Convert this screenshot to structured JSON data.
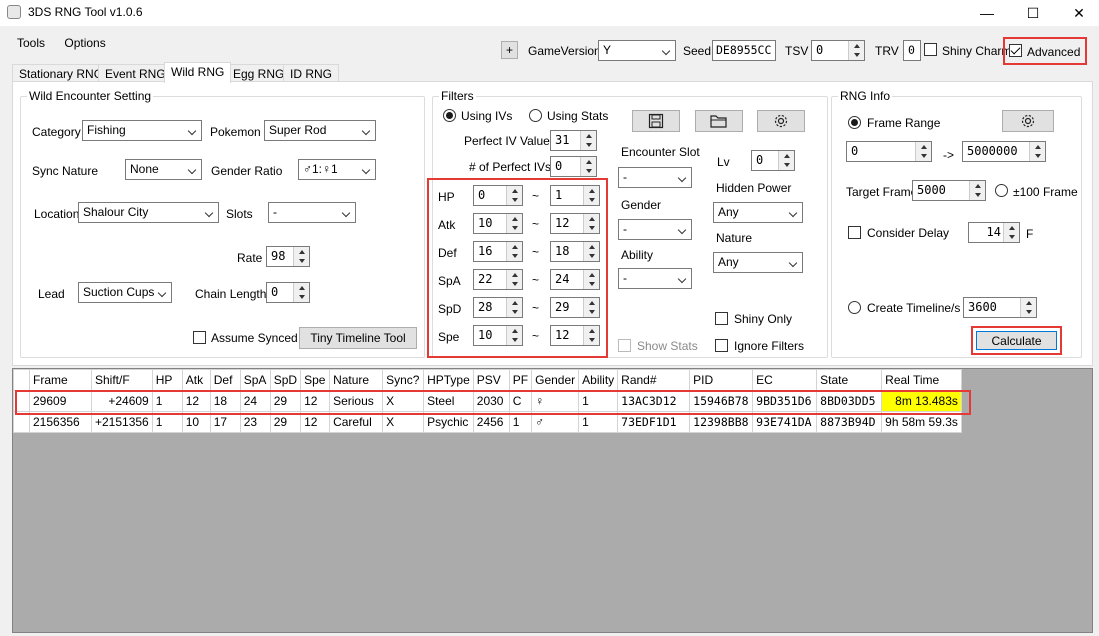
{
  "window": {
    "title": "3DS RNG Tool v1.0.6",
    "minimize": "—",
    "maximize": "☐",
    "close": "✕"
  },
  "menu": [
    "Tools",
    "Options"
  ],
  "toolbar": {
    "plus": "+",
    "game_version_label": "GameVersion",
    "game_version": "Y",
    "seed_label": "Seed",
    "seed": "DE8955CC",
    "tsv_label": "TSV",
    "tsv": "0",
    "trv_label": "TRV",
    "trv": "0",
    "shiny_charm": "Shiny Charm",
    "advanced": "Advanced"
  },
  "tabs": [
    "Stationary RNG",
    "Event RNG",
    "Wild RNG",
    "Egg RNG",
    "ID RNG"
  ],
  "wild": {
    "title": "Wild Encounter Setting",
    "category_label": "Category",
    "category": "Fishing",
    "pokemon_label": "Pokemon",
    "pokemon": "Super Rod",
    "sync_label": "Sync Nature",
    "sync": "None",
    "gender_ratio_label": "Gender Ratio",
    "gender_ratio": "♂1:♀1",
    "location_label": "Location",
    "location": "Shalour City",
    "slots_label": "Slots",
    "slots": "-",
    "rate_label": "Rate",
    "rate": "98",
    "lead_label": "Lead",
    "lead": "Suction Cups",
    "chain_label": "Chain Length",
    "chain": "0",
    "assume_synced": "Assume Synced",
    "tiny_timeline": "Tiny Timeline Tool"
  },
  "filters": {
    "title": "Filters",
    "using_ivs": "Using IVs",
    "using_stats": "Using Stats",
    "perfect_iv_label": "Perfect IV Value",
    "perfect_iv": "31",
    "num_perfect_label": "# of Perfect IVs",
    "num_perfect": "0",
    "tilde": "~",
    "ivs": [
      {
        "stat": "HP",
        "min": "0",
        "max": "1"
      },
      {
        "stat": "Atk",
        "min": "10",
        "max": "12"
      },
      {
        "stat": "Def",
        "min": "16",
        "max": "18"
      },
      {
        "stat": "SpA",
        "min": "22",
        "max": "24"
      },
      {
        "stat": "SpD",
        "min": "28",
        "max": "29"
      },
      {
        "stat": "Spe",
        "min": "10",
        "max": "12"
      }
    ],
    "encounter_slot_label": "Encounter Slot",
    "encounter_slot": "-",
    "gender_label": "Gender",
    "gender": "-",
    "ability_label": "Ability",
    "ability": "-",
    "lv_label": "Lv",
    "lv": "0",
    "hidden_power_label": "Hidden Power",
    "hidden_power": "Any",
    "nature_label": "Nature",
    "nature": "Any",
    "shiny_only": "Shiny Only",
    "show_stats": "Show Stats",
    "ignore_filters": "Ignore Filters"
  },
  "rnginfo": {
    "title": "RNG Info",
    "frame_range": "Frame Range",
    "frame_min": "0",
    "arrow": "->",
    "frame_max": "5000000",
    "target_label": "Target Frame",
    "target": "5000",
    "plus100": "±100 Frame",
    "consider_delay": "Consider Delay",
    "delay": "14",
    "delay_unit": "F",
    "create_timeline": "Create Timeline/s",
    "timeline": "3600",
    "calculate": "Calculate"
  },
  "results": {
    "columns": [
      "Frame",
      "Shift/F",
      "HP",
      "Atk",
      "Def",
      "SpA",
      "SpD",
      "Spe",
      "Nature",
      "Sync?",
      "HPType",
      "PSV",
      "PF",
      "Gender",
      "Ability",
      "Rand#",
      "PID",
      "EC",
      "State",
      "Real Time"
    ],
    "rows": [
      [
        "29609",
        "+24609",
        "1",
        "12",
        "18",
        "24",
        "29",
        "12",
        "Serious",
        "X",
        "Steel",
        "2030",
        "C",
        "♀",
        "1",
        "13AC3D12",
        "15946B78",
        "9BD351D6",
        "8BD03DD5",
        "8m 13.483s"
      ],
      [
        "2156356",
        "+2151356",
        "1",
        "10",
        "17",
        "23",
        "29",
        "12",
        "Careful",
        "X",
        "Psychic",
        "2456",
        "1",
        "♂",
        "1",
        "73EDF1D1",
        "12398BB8",
        "93E741DA",
        "8873B94D",
        "9h 58m 59.3s"
      ]
    ]
  }
}
